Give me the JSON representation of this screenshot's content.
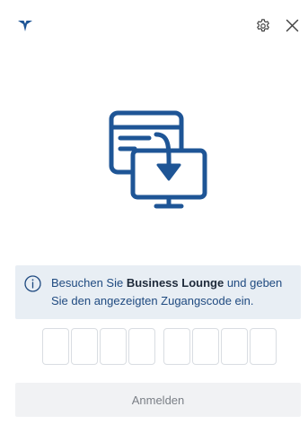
{
  "header": {
    "logo_icon": "airline-logo-icon",
    "settings_icon": "gear-icon",
    "close_icon": "close-icon"
  },
  "hero": {
    "icon": "transfer-to-monitor-icon",
    "color": "#1e5596"
  },
  "info": {
    "icon": "info-icon",
    "text_before": "Besuchen Sie ",
    "highlight": "Business Lounge",
    "text_after": " und geben Sie den angezeigten Zugangscode ein.",
    "background": "#e8eef4"
  },
  "code": {
    "cells": [
      "",
      "",
      "",
      "",
      "",
      "",
      "",
      ""
    ]
  },
  "actions": {
    "login_label": "Anmelden"
  }
}
